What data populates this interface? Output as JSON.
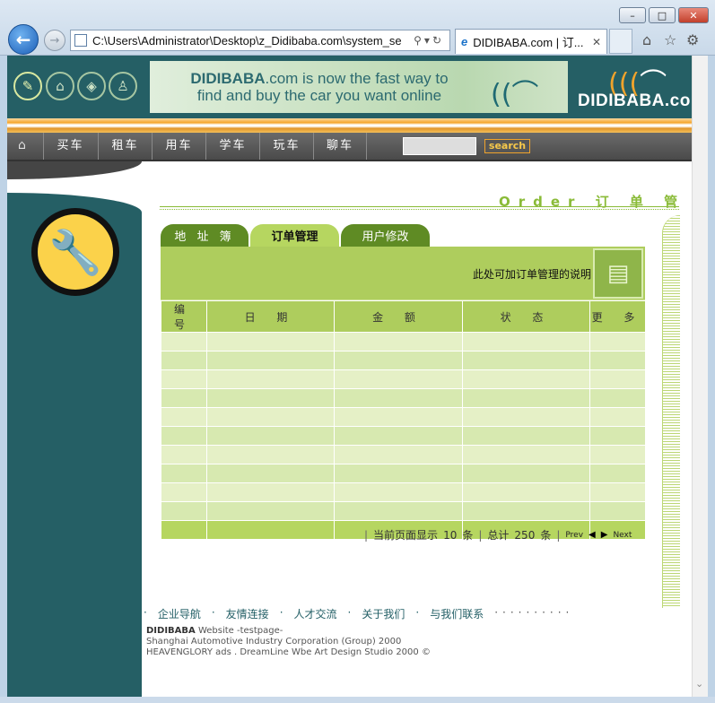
{
  "browser": {
    "address": "C:\\Users\\Administrator\\Desktop\\z_Didibaba.com\\system_se",
    "tab_title": "DIDIBABA.com | 订...",
    "minimize": "–",
    "maximize": "□",
    "close": "✕"
  },
  "banner": {
    "ad_brand": "DIDIBABA",
    "ad_line1_rest": ".com is now the fast way to",
    "ad_line2": "find and buy the car you want online",
    "brand": "DIDIBABA.com"
  },
  "nav": {
    "items": [
      "买车",
      "租车",
      "用车",
      "学车",
      "玩车",
      "聊车"
    ],
    "search_button": "search"
  },
  "page": {
    "order_title": "Order 订 单 管 理",
    "tabs": [
      "地 址 簿",
      "订单管理",
      "用户修改"
    ],
    "description": "此处可加订单管理的说明"
  },
  "table": {
    "headers": [
      "编 号",
      "日 期",
      "金 额",
      "状 态",
      "更 多"
    ],
    "rows": 10
  },
  "pager": {
    "current_label": "当前页面显示",
    "current_count": "10",
    "unit1": "条",
    "total_label": "总计",
    "total_count": "250",
    "unit2": "条",
    "prev": "Prev",
    "next": "Next"
  },
  "footer": {
    "links": [
      "企业导航",
      "友情连接",
      "人才交流",
      "关于我们",
      "与我们联系"
    ],
    "line1_bold": "DIDIBABA",
    "line1_rest": " Website -testpage-",
    "line2": "Shanghai Automotive Industry Corporation (Group) 2000",
    "line3": "HEAVENGLORY ads . DreamLine Wbe Art Design Studio 2000 ©"
  }
}
